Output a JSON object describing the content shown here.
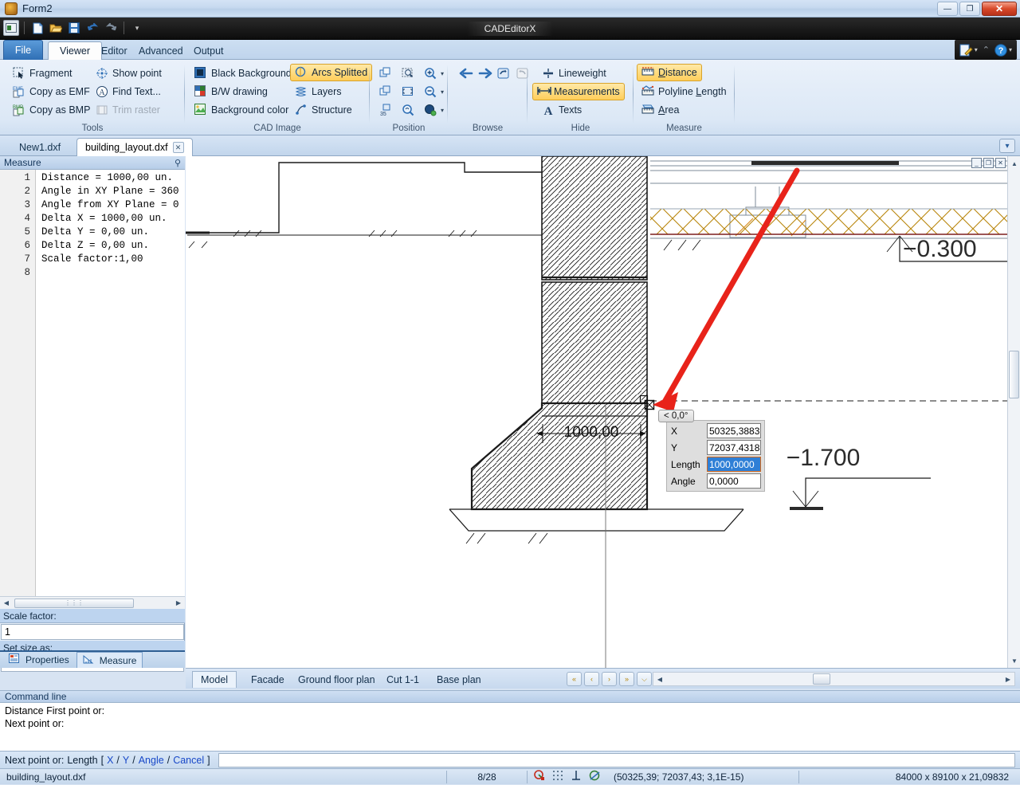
{
  "window": {
    "title": "Form2",
    "app_name": "CADEditorX",
    "buttons": {
      "minimize": "—",
      "maximize": "❐",
      "close": "✕"
    }
  },
  "quick_toolbar": {
    "items": [
      {
        "name": "app-menu-icon",
        "glyph": "▣"
      },
      {
        "name": "new-file-icon",
        "glyph": "🗋"
      },
      {
        "name": "open-file-icon",
        "glyph": "🗁"
      },
      {
        "name": "save-file-icon",
        "glyph": "🖫"
      },
      {
        "name": "undo-icon",
        "glyph": "↺"
      },
      {
        "name": "redo-icon",
        "glyph": "↻"
      },
      {
        "name": "customize-icon",
        "glyph": "▾"
      }
    ]
  },
  "ribbon": {
    "tabs": [
      {
        "label": "File",
        "active": false,
        "kind": "file"
      },
      {
        "label": "Viewer",
        "active": true
      },
      {
        "label": "Editor",
        "active": false
      },
      {
        "label": "Advanced",
        "active": false
      },
      {
        "label": "Output",
        "active": false
      }
    ],
    "right_controls": [
      {
        "name": "edit-style-dropdown",
        "glyph": "✎"
      },
      {
        "name": "collapse-ribbon-icon",
        "glyph": "⌃"
      },
      {
        "name": "help-icon",
        "glyph": "?"
      }
    ],
    "groups": [
      {
        "name": "tools",
        "label": "Tools",
        "items": [
          {
            "label": "Fragment",
            "icon": "fragment-icon",
            "state": "normal"
          },
          {
            "label": "Copy as EMF",
            "icon": "copy-emf-icon",
            "state": "normal"
          },
          {
            "label": "Copy as BMP",
            "icon": "copy-bmp-icon",
            "state": "normal"
          },
          {
            "label": "Show point",
            "icon": "show-point-icon",
            "state": "normal"
          },
          {
            "label": "Find Text...",
            "icon": "find-text-icon",
            "state": "normal"
          },
          {
            "label": "Trim raster",
            "icon": "trim-raster-icon",
            "state": "disabled"
          }
        ]
      },
      {
        "name": "cad-image",
        "label": "CAD Image",
        "items": [
          {
            "label": "Black Background",
            "icon": "black-background-icon",
            "state": "normal"
          },
          {
            "label": "B/W drawing",
            "icon": "bw-drawing-icon",
            "state": "normal"
          },
          {
            "label": "Background color",
            "icon": "background-color-icon",
            "state": "normal"
          },
          {
            "label": "Arcs Splitted",
            "icon": "arcs-splitted-icon",
            "state": "checked"
          },
          {
            "label": "Layers",
            "icon": "layers-icon",
            "state": "normal"
          },
          {
            "label": "Structure",
            "icon": "structure-icon",
            "state": "normal"
          }
        ]
      },
      {
        "name": "position",
        "label": "Position",
        "items": [
          {
            "label": "",
            "icon": "pan-icon",
            "state": "normal"
          },
          {
            "label": "",
            "icon": "zoom-window-icon",
            "state": "normal"
          },
          {
            "label": "",
            "icon": "zoom-in-icon",
            "state": "dropdown"
          },
          {
            "label": "",
            "icon": "fit-page-icon",
            "state": "normal"
          },
          {
            "label": "",
            "icon": "zoom-extents-icon",
            "state": "normal"
          },
          {
            "label": "",
            "icon": "zoom-out-icon",
            "state": "dropdown"
          },
          {
            "label": "",
            "icon": "rotate-35-icon",
            "state": "normal"
          },
          {
            "label": "",
            "icon": "zoom-previous-icon",
            "state": "normal"
          },
          {
            "label": "",
            "icon": "view-style-icon",
            "state": "dropdown"
          }
        ]
      },
      {
        "name": "browse",
        "label": "Browse",
        "items": [
          {
            "label": "",
            "icon": "back-arrow-icon",
            "state": "normal"
          },
          {
            "label": "",
            "icon": "forward-arrow-icon",
            "state": "normal"
          },
          {
            "label": "",
            "icon": "refresh-view-icon",
            "state": "normal"
          },
          {
            "label": "",
            "icon": "redo-view-icon",
            "state": "disabled"
          }
        ]
      },
      {
        "name": "hide",
        "label": "Hide",
        "items": [
          {
            "label": "Lineweight",
            "icon": "lineweight-icon",
            "state": "normal"
          },
          {
            "label": "Measurements",
            "icon": "measurements-icon",
            "state": "checked"
          },
          {
            "label": "Texts",
            "icon": "texts-icon",
            "state": "normal"
          }
        ]
      },
      {
        "name": "measure",
        "label": "Measure",
        "items": [
          {
            "label": "Distance",
            "icon": "distance-icon",
            "state": "checked"
          },
          {
            "label": "Polyline Length",
            "icon": "polyline-length-icon",
            "state": "normal"
          },
          {
            "label": "Area",
            "icon": "area-icon",
            "state": "normal"
          }
        ]
      }
    ]
  },
  "document_tabs": {
    "items": [
      {
        "label": "New1.dxf",
        "active": false,
        "closable": false
      },
      {
        "label": "building_layout.dxf",
        "active": true,
        "closable": true
      }
    ],
    "close_glyph": "✕",
    "overflow_glyph": "▾"
  },
  "measure_panel": {
    "caption": "Measure",
    "pin_glyph": "⚲",
    "lines": [
      {
        "n": "1",
        "text": "Distance = 1000,00 un."
      },
      {
        "n": "2",
        "text": "Angle in XY Plane = 360"
      },
      {
        "n": "3",
        "text": "Angle from XY Plane = 0"
      },
      {
        "n": "4",
        "text": "Delta X = 1000,00 un."
      },
      {
        "n": "5",
        "text": "Delta Y = 0,00 un."
      },
      {
        "n": "6",
        "text": "Delta Z = 0,00 un."
      },
      {
        "n": "7",
        "text": "Scale factor:1,00"
      },
      {
        "n": "8",
        "text": ""
      }
    ],
    "scale_factor_label": "Scale factor:",
    "scale_factor_value": "1",
    "set_size_label": "Set size as:",
    "set_size_value": ""
  },
  "dock_tabs": [
    {
      "label": "Properties",
      "icon": "properties-icon",
      "active": false
    },
    {
      "label": "Measure",
      "icon": "measure-icon",
      "active": true
    }
  ],
  "drawing": {
    "dimension_label": "1000,00",
    "elevation_top": "−0.300",
    "elevation_bottom": "−1.700",
    "angle_tooltip": "< 0,0°"
  },
  "coord_entry": {
    "rows": [
      {
        "label": "X",
        "value": "50325,3883",
        "selected": false
      },
      {
        "label": "Y",
        "value": "72037,4318",
        "selected": false
      },
      {
        "label": "Length",
        "value": "1000,0000",
        "selected": true
      },
      {
        "label": "Angle",
        "value": "0,0000",
        "selected": false
      }
    ]
  },
  "layout_tabs": {
    "items": [
      {
        "label": "Model",
        "active": true
      },
      {
        "label": "Facade",
        "active": false
      },
      {
        "label": "Ground floor plan",
        "active": false
      },
      {
        "label": "Cut 1-1",
        "active": false
      },
      {
        "label": "Base plan",
        "active": false
      }
    ],
    "nav_buttons": [
      {
        "name": "first-layout-button",
        "glyph": "«"
      },
      {
        "name": "prev-layout-button",
        "glyph": "‹"
      },
      {
        "name": "next-layout-button",
        "glyph": "›"
      },
      {
        "name": "last-layout-button",
        "glyph": "»"
      },
      {
        "name": "layout-list-button",
        "glyph": "⌵"
      }
    ]
  },
  "command_line": {
    "caption": "Command line",
    "history": [
      "Distance First point or:",
      "Next point or:"
    ],
    "prompt": "Next point or:",
    "option_prefix": "Length",
    "bracket_open": "[",
    "options": [
      "X",
      "Y",
      "Angle",
      "Cancel"
    ],
    "separator": "/",
    "bracket_close": "]",
    "input_value": ""
  },
  "status_bar": {
    "file_name": "building_layout.dxf",
    "entity_count": "8/28",
    "snap_icons": [
      {
        "name": "osnap-icon",
        "glyph": "◔"
      },
      {
        "name": "grid-snap-icon",
        "glyph": "∷"
      },
      {
        "name": "ortho-icon",
        "glyph": "⊥"
      },
      {
        "name": "otrack-icon",
        "glyph": "⊘"
      }
    ],
    "coordinates": "(50325,39; 72037,43; 3,1E-15)",
    "extents": "84000 x 89100 x 21,09832"
  }
}
